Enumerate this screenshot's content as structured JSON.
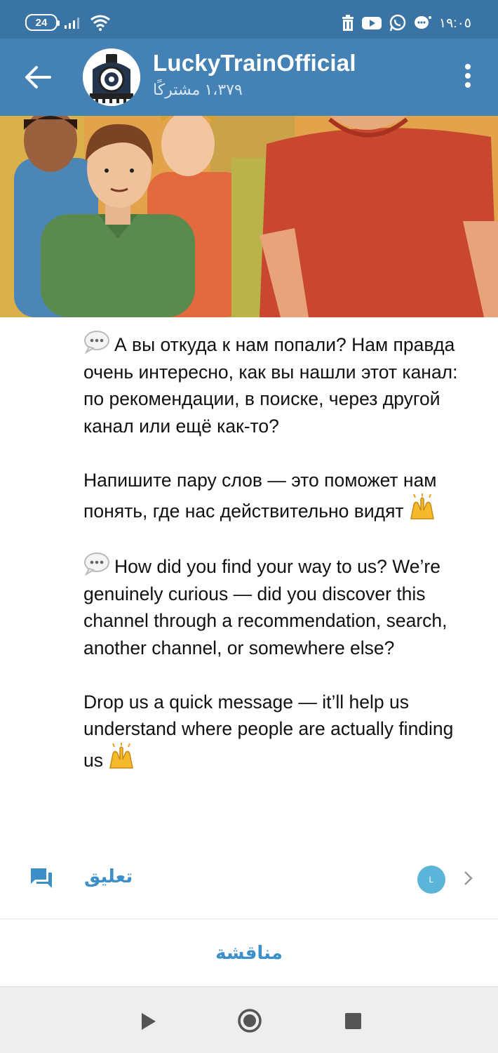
{
  "status_bar": {
    "battery": "24",
    "time": "١٩:٠٥",
    "icons": [
      "signal-icon",
      "wifi-icon",
      "trash-icon",
      "youtube-icon",
      "whatsapp-icon",
      "chat-bubble-icon"
    ]
  },
  "header": {
    "title": "LuckyTrainOfficial",
    "subscribers": "١،٣٧٩ مشترکًا"
  },
  "post": {
    "paragraphs": [
      {
        "emoji": "speech-balloon-icon",
        "text": "А вы откуда к нам попали? Нам правда очень интересно, как вы нашли этот канал: по рекомендации, в поиске, через другой канал или ещё как-то?"
      },
      {
        "text": "Напишите пару слов — это поможет нам понять, где нас действительно видят",
        "trailing_emoji": "raised-hands-icon"
      },
      {
        "emoji": "speech-balloon-icon",
        "text": "How did you find your way to us? We’re genuinely curious — did you discover this channel through a recommendation, search, another channel, or somewhere else?"
      },
      {
        "text": "Drop us a quick message — it’ll help us understand where people are actually finding us",
        "trailing_emoji": "raised-hands-icon"
      }
    ]
  },
  "comments": {
    "label": "تعليق",
    "avatar_initial": "L"
  },
  "discussion_label": "مناقشة",
  "colors": {
    "status_bar": "#3a74a4",
    "header": "#4482b5",
    "accent": "#3c8fc8"
  }
}
